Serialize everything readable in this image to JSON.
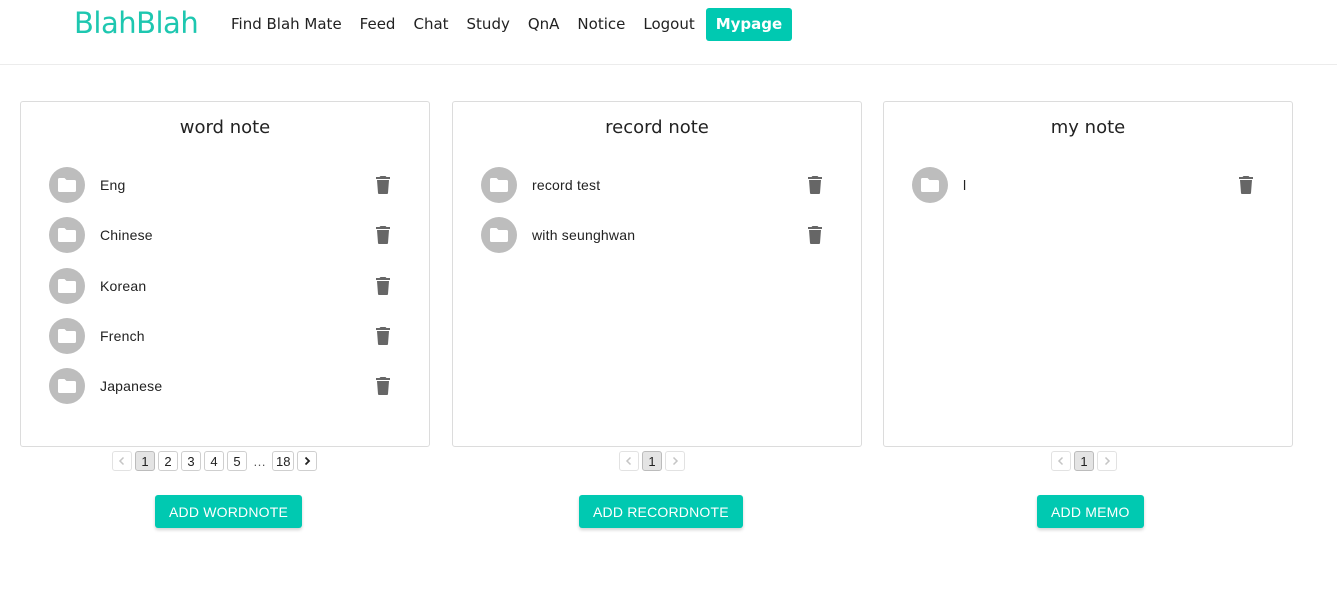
{
  "app": {
    "logo": "BlahBlah"
  },
  "nav": {
    "items": [
      "Find Blah Mate",
      "Feed",
      "Chat",
      "Study",
      "QnA",
      "Notice",
      "Logout"
    ],
    "active": "Mypage"
  },
  "word_note": {
    "title": "word note",
    "items": [
      "Eng",
      "Chinese",
      "Korean",
      "French",
      "Japanese"
    ],
    "pagination": {
      "pages": [
        "1",
        "2",
        "3",
        "4",
        "5"
      ],
      "ellipsis": "…",
      "last": "18",
      "current": 1
    },
    "add_label": "ADD WORDNOTE"
  },
  "record_note": {
    "title": "record note",
    "items": [
      "record test",
      "with seunghwan"
    ],
    "pagination": {
      "pages": [
        "1"
      ],
      "current": 1
    },
    "add_label": "ADD RECORDNOTE"
  },
  "my_note": {
    "title": "my note",
    "items": [
      "l"
    ],
    "pagination": {
      "pages": [
        "1"
      ],
      "current": 1
    },
    "add_label": "ADD MEMO"
  },
  "colors": {
    "accent": "#00c9b1",
    "logo": "#1ec7b0",
    "avatar": "#bdbdbd",
    "trash": "#666666"
  },
  "icons": {
    "folder": "folder-icon",
    "trash": "trash-icon",
    "prev": "chevron-left-icon",
    "next": "chevron-right-icon"
  }
}
